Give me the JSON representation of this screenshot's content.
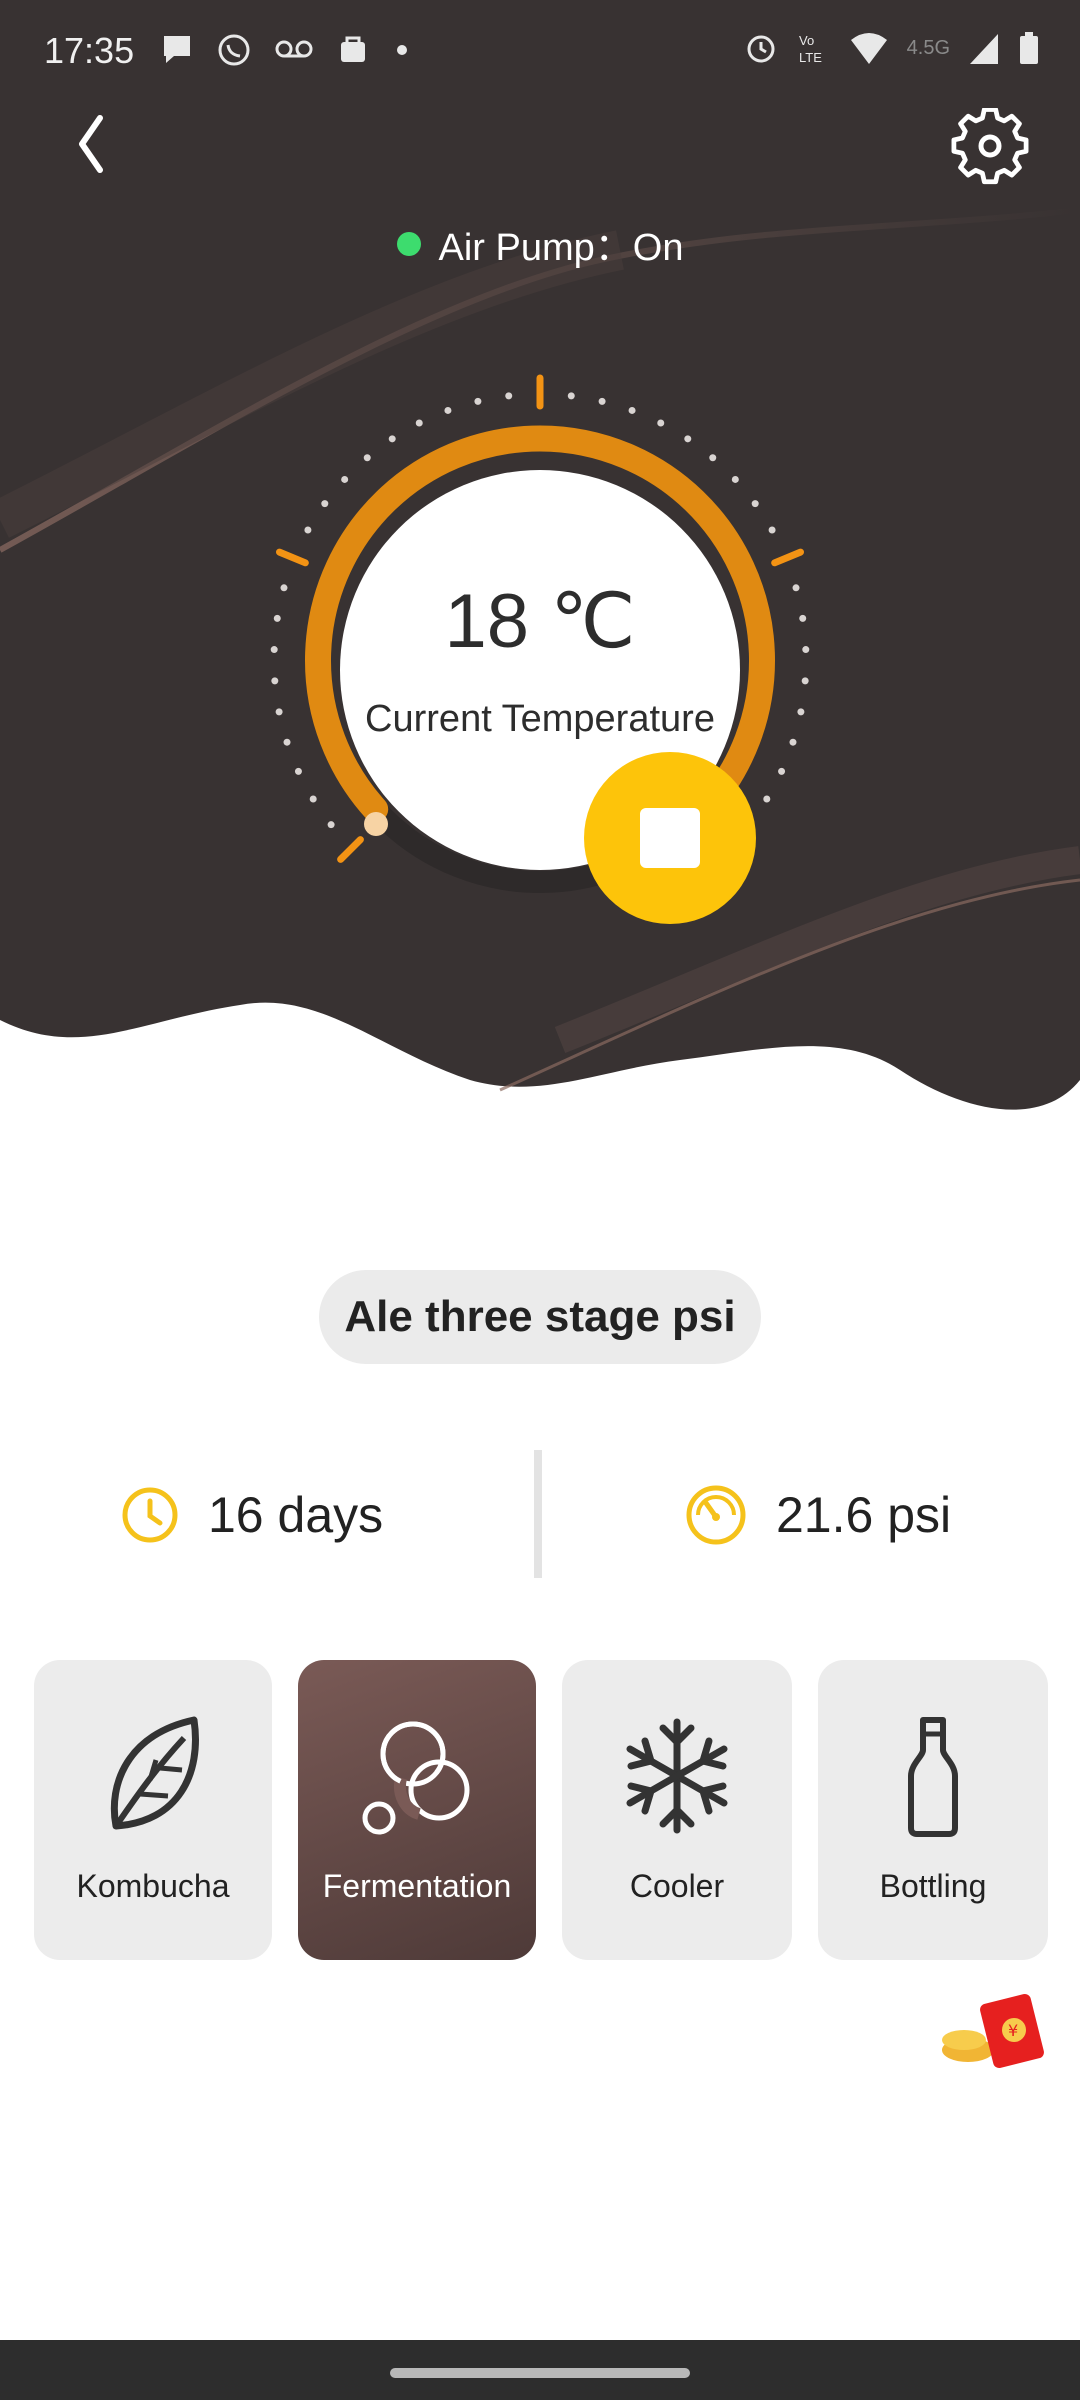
{
  "status_bar": {
    "time": "17:35",
    "icons_left": [
      "chat-bubble-icon",
      "whatsapp-icon",
      "voicemail-icon",
      "bag-icon",
      "dot-icon"
    ],
    "icons_right": [
      "alarm-icon",
      "volte-icon",
      "wifi-icon",
      "signal-icon",
      "battery-icon"
    ],
    "network": "4.5G"
  },
  "header": {
    "back_icon": "chevron-left-icon",
    "settings_icon": "gear-icon"
  },
  "air_pump": {
    "label": "Air Pump：",
    "value": "On",
    "indicator_color": "#3ddc6e"
  },
  "dial": {
    "temperature": "18 ℃",
    "label": "Current Temperature",
    "arc_color": "#e08a12",
    "stop_button_color": "#fdc40a"
  },
  "program": {
    "name": "Ale three stage psi"
  },
  "stats": {
    "duration": "16 days",
    "pressure": "21.6 psi",
    "icon_color": "#f5c21b"
  },
  "modes": [
    {
      "label": "Kombucha",
      "icon": "leaf-icon",
      "active": false
    },
    {
      "label": "Fermentation",
      "icon": "bubbles-icon",
      "active": true
    },
    {
      "label": "Cooler",
      "icon": "snowflake-icon",
      "active": false
    },
    {
      "label": "Bottling",
      "icon": "bottle-icon",
      "active": false
    }
  ],
  "colors": {
    "hero_background": "#383232",
    "accent": "#e08a12",
    "active_card": "#6a4e4b"
  }
}
